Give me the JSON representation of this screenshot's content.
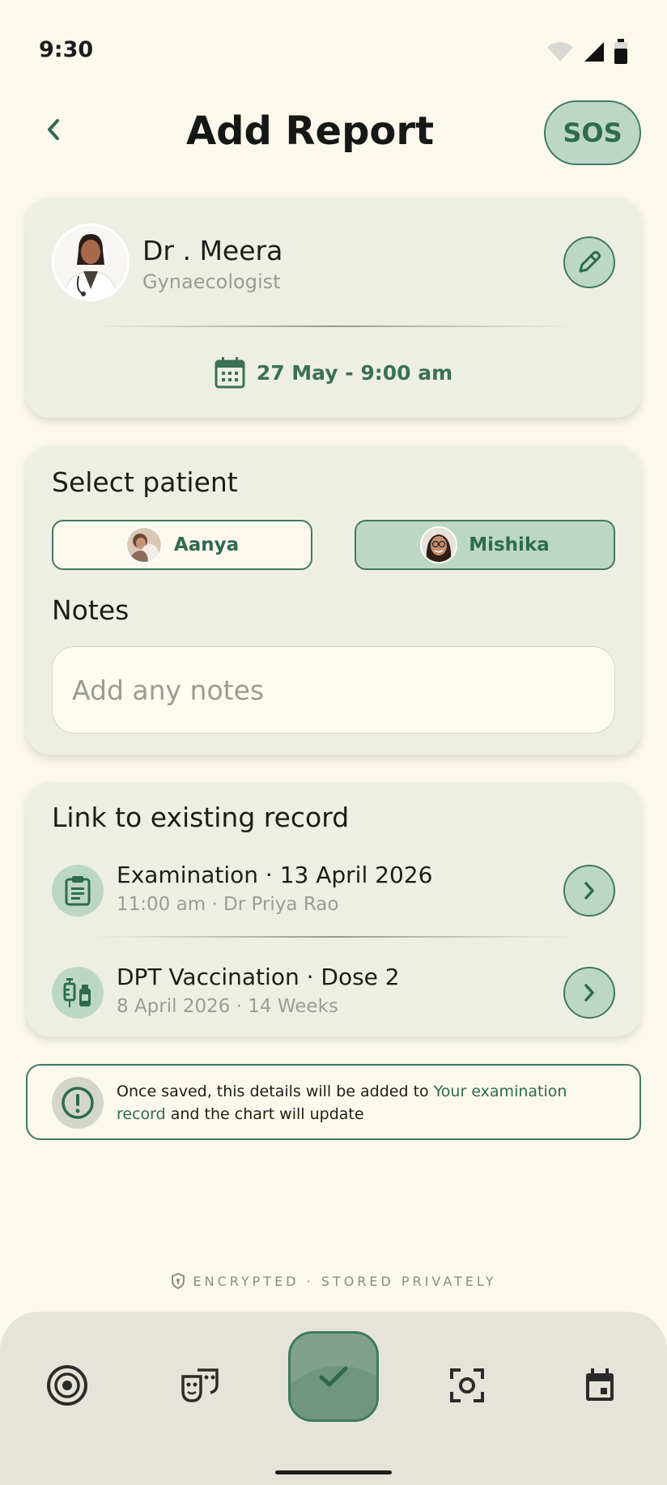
{
  "status_bar": {
    "time": "9:30"
  },
  "header": {
    "title": "Add Report",
    "sos_label": "SOS"
  },
  "doctor": {
    "name": "Dr . Meera",
    "specialty": "Gynaecologist",
    "appointment": "27 May - 9:00 am"
  },
  "patient_section": {
    "title": "Select patient",
    "patients": [
      {
        "name": "Aanya",
        "selected": false
      },
      {
        "name": "Mishika",
        "selected": true
      }
    ],
    "notes_title": "Notes",
    "notes_placeholder": "Add any notes"
  },
  "records_section": {
    "title": "Link to existing record",
    "records": [
      {
        "title": "Examination · 13 April 2026",
        "subtitle": "11:00 am · Dr Priya Rao",
        "icon": "clipboard-icon"
      },
      {
        "title": "DPT Vaccination · Dose 2",
        "subtitle": "8 April 2026 · 14 Weeks",
        "icon": "vaccine-icon"
      }
    ]
  },
  "info": {
    "text_before": "Once saved, this details will be added to ",
    "link_text": "Your examination record",
    "text_after": " and the chart will update"
  },
  "footer_note": "ENCRYPTED · STORED PRIVATELY",
  "bottom_nav": {
    "items": [
      "flower-icon",
      "masks-icon",
      "check-icon",
      "scan-icon",
      "calendar-icon"
    ]
  },
  "colors": {
    "background": "#fcf8ec",
    "accent": "#3f7a62",
    "accent_light": "#bdd7c6",
    "card": "#eeefe4"
  }
}
